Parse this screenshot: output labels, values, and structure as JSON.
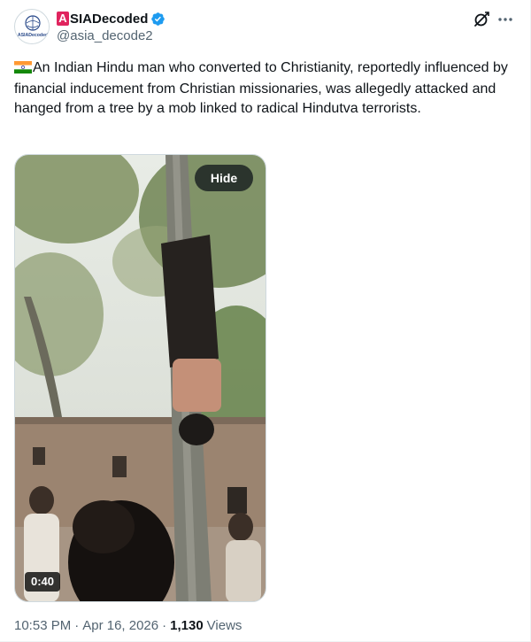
{
  "author": {
    "name_prefix": "A",
    "name_rest": "SIADecoded",
    "handle": "@asia_decode2",
    "avatar_text": "ASIADecoded",
    "verified": true
  },
  "post": {
    "flag": "india-flag-emoji",
    "text": "An Indian Hindu man who converted to Christianity, reportedly influenced by financial inducement from Christian missionaries, was allegedly attacked and hanged from a tree by a mob linked to radical Hindutva terrorists."
  },
  "media": {
    "hide_label": "Hide",
    "duration": "0:40"
  },
  "meta": {
    "time": "10:53 PM",
    "separator": "·",
    "date": "Apr 16, 2026",
    "views_count": "1,130",
    "views_label": "Views"
  },
  "colors": {
    "verified": "#1d9bf0",
    "brand_red": "#e0245e",
    "secondary_text": "#536471"
  },
  "icons": [
    "grok-icon",
    "more-icon",
    "verified-badge-icon"
  ]
}
